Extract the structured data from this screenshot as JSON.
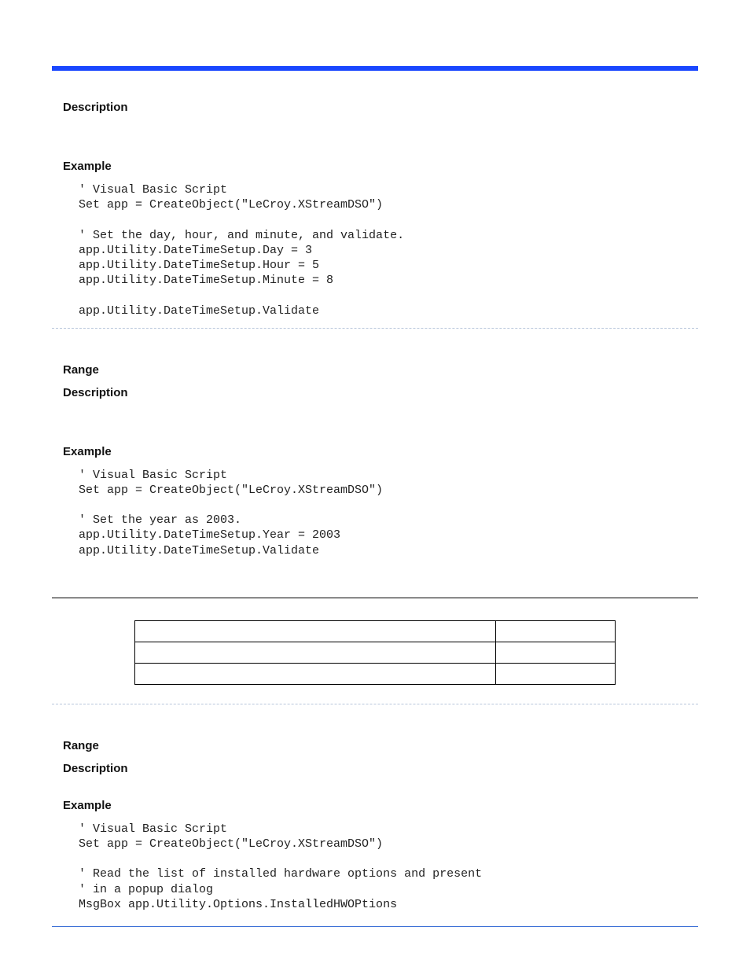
{
  "headings": {
    "description": "Description",
    "example": "Example",
    "range": "Range"
  },
  "blocks": {
    "code1": "' Visual Basic Script\nSet app = CreateObject(\"LeCroy.XStreamDSO\")\n\n' Set the day, hour, and minute, and validate.\napp.Utility.DateTimeSetup.Day = 3\napp.Utility.DateTimeSetup.Hour = 5\napp.Utility.DateTimeSetup.Minute = 8\n\napp.Utility.DateTimeSetup.Validate",
    "code2": "' Visual Basic Script\nSet app = CreateObject(\"LeCroy.XStreamDSO\")\n\n' Set the year as 2003.\napp.Utility.DateTimeSetup.Year = 2003\napp.Utility.DateTimeSetup.Validate",
    "code3": "' Visual Basic Script\nSet app = CreateObject(\"LeCroy.XStreamDSO\")\n\n' Read the list of installed hardware options and present\n' in a popup dialog\nMsgBox app.Utility.Options.InstalledHWOPtions"
  },
  "table": {
    "rows": 3,
    "cols": 2
  }
}
